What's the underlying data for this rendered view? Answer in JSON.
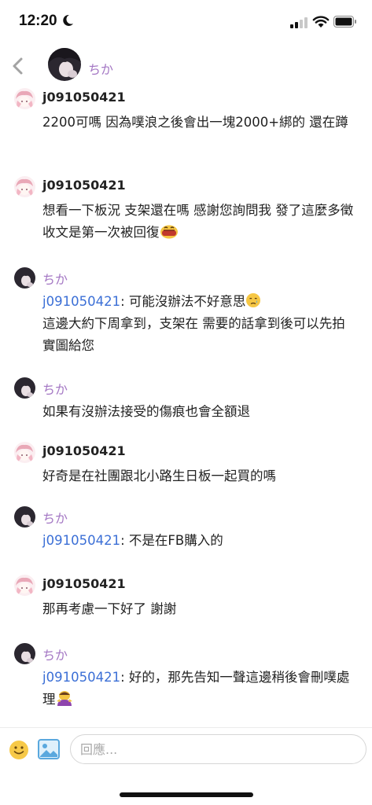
{
  "status_bar": {
    "time": "12:20"
  },
  "header": {
    "name": "ちか"
  },
  "messages": [
    {
      "sender": "j091050421",
      "text": "2200可嗎 因為噗浪之後會出一塊2000+綁的 還在蹲"
    },
    {
      "sender": "j091050421",
      "text": "想看一下板況 支架還在嗎 感謝您詢問我 發了這麼多徵收文是第一次被回復"
    },
    {
      "sender": "ちか",
      "mention": "j091050421",
      "text": ": 可能沒辦法不好意思",
      "text2": "這邊大約下周拿到，支架在 需要的話拿到後可以先拍實圖給您"
    },
    {
      "sender": "ちか",
      "text": "如果有沒辦法接受的傷痕也會全額退"
    },
    {
      "sender": "j091050421",
      "text": "好奇是在社團跟北小路生日板一起買的嗎"
    },
    {
      "sender": "ちか",
      "mention": "j091050421",
      "text": ": 不是在FB購入的"
    },
    {
      "sender": "j091050421",
      "text": "那再考慮一下好了 謝謝"
    },
    {
      "sender": "ちか",
      "mention": "j091050421",
      "text": ": 好的，那先告知一聲這邊稍後會刪噗處理"
    }
  ],
  "composer": {
    "placeholder": "回應..."
  },
  "colors": {
    "owner_name": "#a477c4",
    "mention": "#3b6fd6"
  },
  "icons": [
    "moon-icon",
    "signal-icon",
    "wifi-icon",
    "battery-icon",
    "back-icon",
    "smiley-icon",
    "image-icon",
    "crying-emoji",
    "embarrassed-emoji",
    "bowing-emoji"
  ]
}
